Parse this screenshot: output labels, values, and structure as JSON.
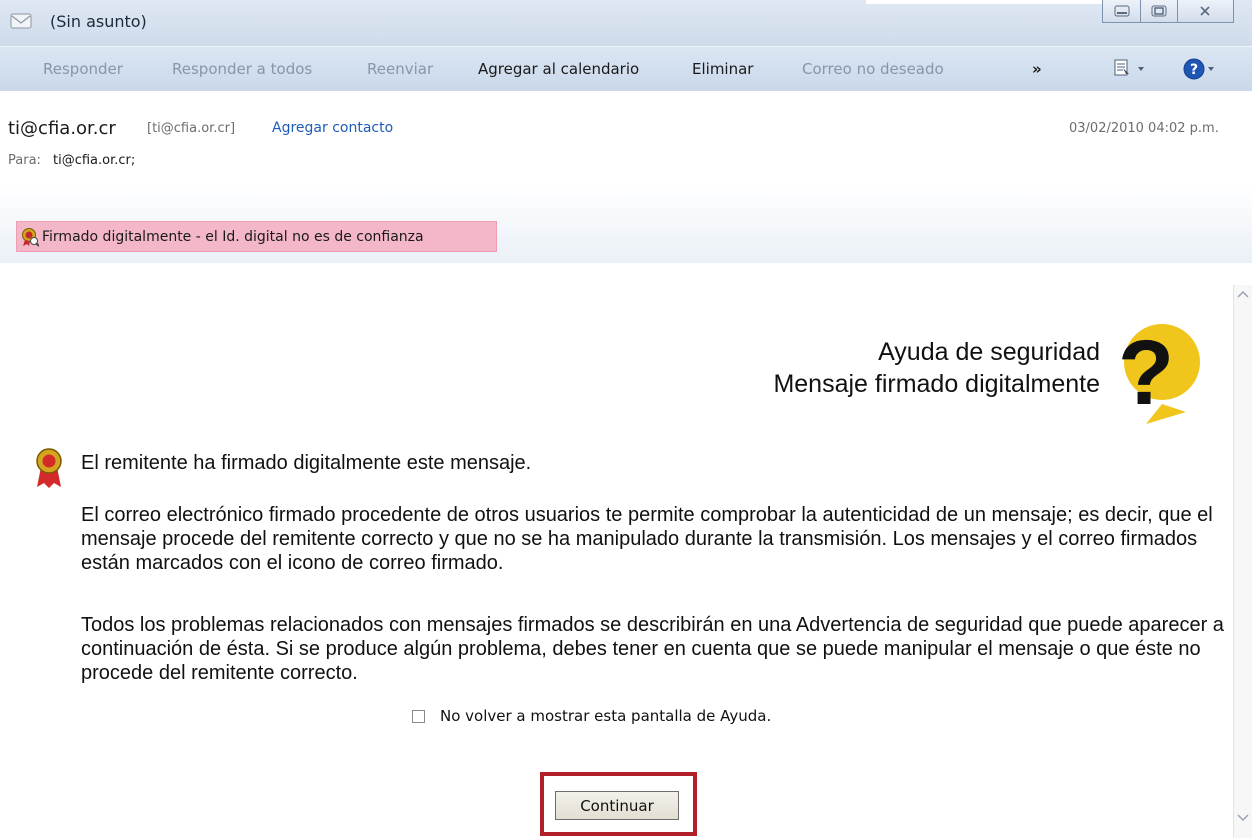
{
  "window": {
    "title": "(Sin asunto)",
    "controls": {
      "minimize": "minimize-icon",
      "maximize": "maximize-icon",
      "close": "close-icon"
    }
  },
  "toolbar": {
    "reply": "Responder",
    "reply_all": "Responder a todos",
    "forward": "Reenviar",
    "add_to_calendar": "Agregar al calendario",
    "delete": "Eliminar",
    "junk": "Correo no deseado",
    "more": "»"
  },
  "header": {
    "sender_name": "ti@cfia.or.cr",
    "sender_address": "[ti@cfia.or.cr]",
    "add_contact": "Agregar contacto",
    "date": "03/02/2010 04:02 p.m.",
    "to_label": "Para:",
    "to_value": "ti@cfia.or.cr;"
  },
  "signature_bar": {
    "text": "Firmado digitalmente - el Id. digital no es de confianza",
    "color": "#f4b7c7"
  },
  "help": {
    "title_line1": "Ayuda de seguridad",
    "title_line2": "Mensaje firmado digitalmente",
    "line1": "El remitente ha firmado digitalmente este mensaje.",
    "paragraph1": "El correo electrónico firmado procedente de otros usuarios te permite comprobar la autenticidad de un mensaje; es decir, que el mensaje procede del remitente correcto y que no se ha manipulado durante la transmisión. Los mensajes y el correo firmados están marcados con el icono de correo firmado.",
    "paragraph2": "Todos los problemas relacionados con mensajes firmados se describirán en una Advertencia de seguridad que puede aparecer a continuación de ésta. Si se produce algún problema, debes tener en cuenta que se puede manipular el mensaje o que éste no procede del remitente correcto.",
    "checkbox_label": "No volver a mostrar esta pantalla de Ayuda.",
    "checkbox_checked": false,
    "continue_label": "Continuar",
    "highlight_color": "#b2202a"
  }
}
